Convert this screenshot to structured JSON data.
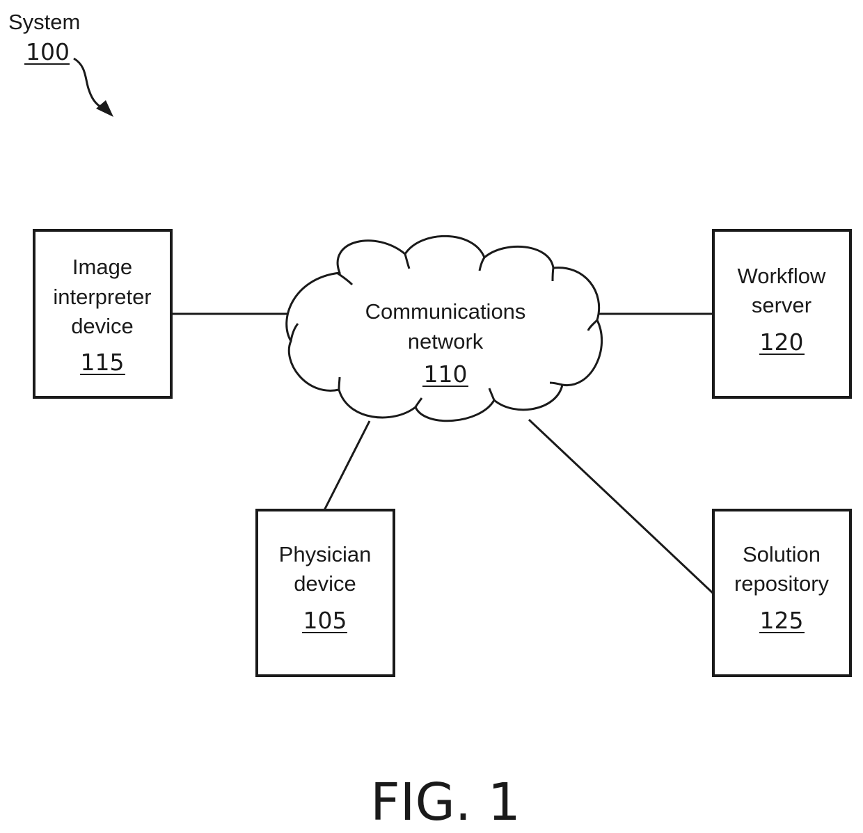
{
  "system": {
    "label": "System",
    "ref": "100"
  },
  "network": {
    "lines": [
      "Communications",
      "network"
    ],
    "ref": "110"
  },
  "nodes": [
    {
      "id": "image-interpreter-device",
      "lines": [
        "Image",
        "interpreter",
        "device"
      ],
      "ref": "115"
    },
    {
      "id": "workflow-server",
      "lines": [
        "Workflow",
        "server"
      ],
      "ref": "120"
    },
    {
      "id": "physician-device",
      "lines": [
        "Physician",
        "device"
      ],
      "ref": "105"
    },
    {
      "id": "solution-repository",
      "lines": [
        "Solution",
        "repository"
      ],
      "ref": "125"
    }
  ],
  "connections": [
    {
      "from": "communications-network",
      "to": "image-interpreter-device"
    },
    {
      "from": "communications-network",
      "to": "workflow-server"
    },
    {
      "from": "communications-network",
      "to": "physician-device"
    },
    {
      "from": "communications-network",
      "to": "solution-repository"
    }
  ],
  "figure_label": "FIG. 1"
}
